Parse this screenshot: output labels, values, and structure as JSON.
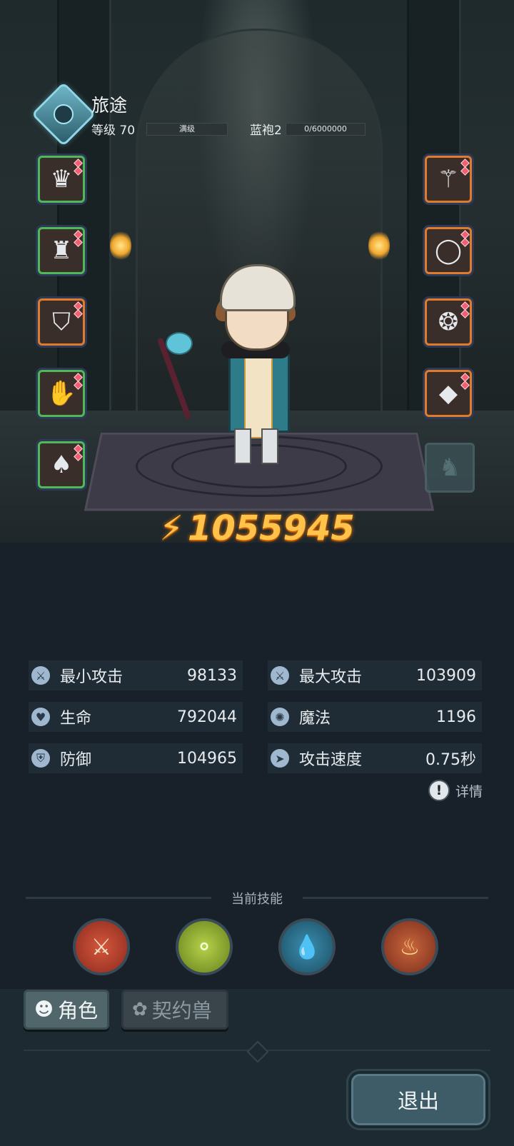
{
  "header": {
    "class_name": "旅途",
    "level_label": "等级 70",
    "level_bar_text": "满级",
    "rank_label": "蓝袍2",
    "rank_progress": "0/6000000",
    "class_emblem_icon": "class-emblem-icon"
  },
  "equipment": {
    "left": [
      {
        "slot": "helmet",
        "icon": "horned-helmet-icon",
        "rarity": "green",
        "glyph": "♛"
      },
      {
        "slot": "armor",
        "icon": "robe-icon",
        "rarity": "green",
        "glyph": "♜"
      },
      {
        "slot": "boots",
        "icon": "boots-icon",
        "rarity": "orange",
        "glyph": "⛉"
      },
      {
        "slot": "gloves",
        "icon": "bracer-icon",
        "rarity": "green",
        "glyph": "✋"
      },
      {
        "slot": "cloak",
        "icon": "cloak-icon",
        "rarity": "green",
        "glyph": "♠"
      }
    ],
    "right": [
      {
        "slot": "weapon",
        "icon": "staff-icon",
        "rarity": "orange",
        "glyph": "⚚"
      },
      {
        "slot": "ring",
        "icon": "ring-icon",
        "rarity": "orange",
        "glyph": "◯"
      },
      {
        "slot": "necklace",
        "icon": "necklace-icon",
        "rarity": "orange",
        "glyph": "❂"
      },
      {
        "slot": "amulet",
        "icon": "amulet-icon",
        "rarity": "orange",
        "glyph": "◆"
      }
    ],
    "mount_slot_icon": "mount-slot-icon"
  },
  "power": {
    "value": "1055945",
    "icon": "power-bolt-icon",
    "glyph": "⚡"
  },
  "stats": [
    {
      "label": "最小攻击",
      "value": "98133",
      "icon": "sword-icon",
      "glyph": "⚔"
    },
    {
      "label": "最大攻击",
      "value": "103909",
      "icon": "swords-icon",
      "glyph": "⚔"
    },
    {
      "label": "生命",
      "value": "792044",
      "icon": "heart-icon",
      "glyph": "♥"
    },
    {
      "label": "魔法",
      "value": "1196",
      "icon": "magic-icon",
      "glyph": "✺"
    },
    {
      "label": "防御",
      "value": "104965",
      "icon": "shield-icon",
      "glyph": "⛨"
    },
    {
      "label": "攻击速度",
      "value": "0.75秒",
      "icon": "speed-icon",
      "glyph": "➤"
    }
  ],
  "details_label": "详情",
  "details_icon_glyph": "!",
  "skills": {
    "title": "当前技能",
    "items": [
      {
        "icon": "crossed-axes-skill-icon",
        "glyph": "⚔",
        "bg": "#b23a2a"
      },
      {
        "icon": "orbs-skill-icon",
        "glyph": "⚬",
        "bg": "#8fae2a"
      },
      {
        "icon": "water-shield-skill-icon",
        "glyph": "💧",
        "bg": "#2b6f8a"
      },
      {
        "icon": "flame-shield-skill-icon",
        "glyph": "♨",
        "bg": "#a8452f"
      }
    ]
  },
  "tabs": [
    {
      "label": "角色",
      "icon": "character-tab-icon",
      "glyph": "☻"
    },
    {
      "label": "契约兽",
      "icon": "paw-tab-icon",
      "glyph": "✿"
    }
  ],
  "exit_label": "退出",
  "colors": {
    "power": "#ffc24a",
    "green_rarity": "#4fb95a",
    "orange_rarity": "#e07a2c",
    "background": "#18212a"
  }
}
